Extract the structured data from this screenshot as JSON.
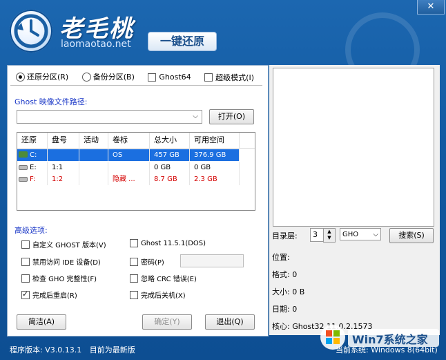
{
  "header": {
    "brand": "老毛桃",
    "site": "laomaotao.net",
    "badge": "一键还原"
  },
  "window": {
    "close_label": "✕"
  },
  "mode": {
    "restore_partition": "还原分区(R)",
    "backup_partition": "备份分区(B)",
    "ghost64": "Ghost64",
    "super_mode": "超级模式(I)"
  },
  "ghost_path": {
    "label": "Ghost 映像文件路径:",
    "value": "",
    "open_button": "打开(O)"
  },
  "table": {
    "headers": [
      "还原",
      "盘号",
      "活动",
      "卷标",
      "总大小",
      "可用空间"
    ],
    "rows": [
      {
        "drive": "C:",
        "disk": "",
        "active": "",
        "label": "OS",
        "total": "457 GB",
        "free": "376.9 GB",
        "selected": true
      },
      {
        "drive": "E:",
        "disk": "1:1",
        "active": "",
        "label": "",
        "total": "0 GB",
        "free": "0 GB"
      },
      {
        "drive": "F:",
        "disk": "1:2",
        "active": "",
        "label": "隐藏 ...",
        "total": "8.7 GB",
        "free": "2.3 GB"
      }
    ]
  },
  "advanced": {
    "label": "高级选项:",
    "custom_ghost_version": "自定义 GHOST 版本(V)",
    "ghost_version": "Ghost 11.5.1(DOS)",
    "disable_ide": "禁用访问 IDE 设备(D)",
    "password": "密码(P)",
    "check_gho": "检查 GHO 完整性(F)",
    "ignore_crc": "忽略 CRC 错误(E)",
    "reboot_after": "完成后重启(R)",
    "shutdown_after": "完成后关机(X)"
  },
  "buttons": {
    "simple": "简洁(A)",
    "confirm": "确定(Y)",
    "exit": "退出(Q)"
  },
  "right": {
    "dir_level_label": "目录层:",
    "dir_level_value": "3",
    "ext_value": "GHO",
    "search_button": "搜索(S)",
    "location": "位置:",
    "format": "格式: 0",
    "size": "大小: 0 B",
    "date": "日期: 0",
    "core": "核心: Ghost32 11.0.2.1573"
  },
  "status": {
    "version": "程序版本: V3.0.13.1",
    "update": "目前为最新版",
    "current_system": "当前系统: Windows 8(64bit)"
  },
  "watermark": "Win7系统之家"
}
